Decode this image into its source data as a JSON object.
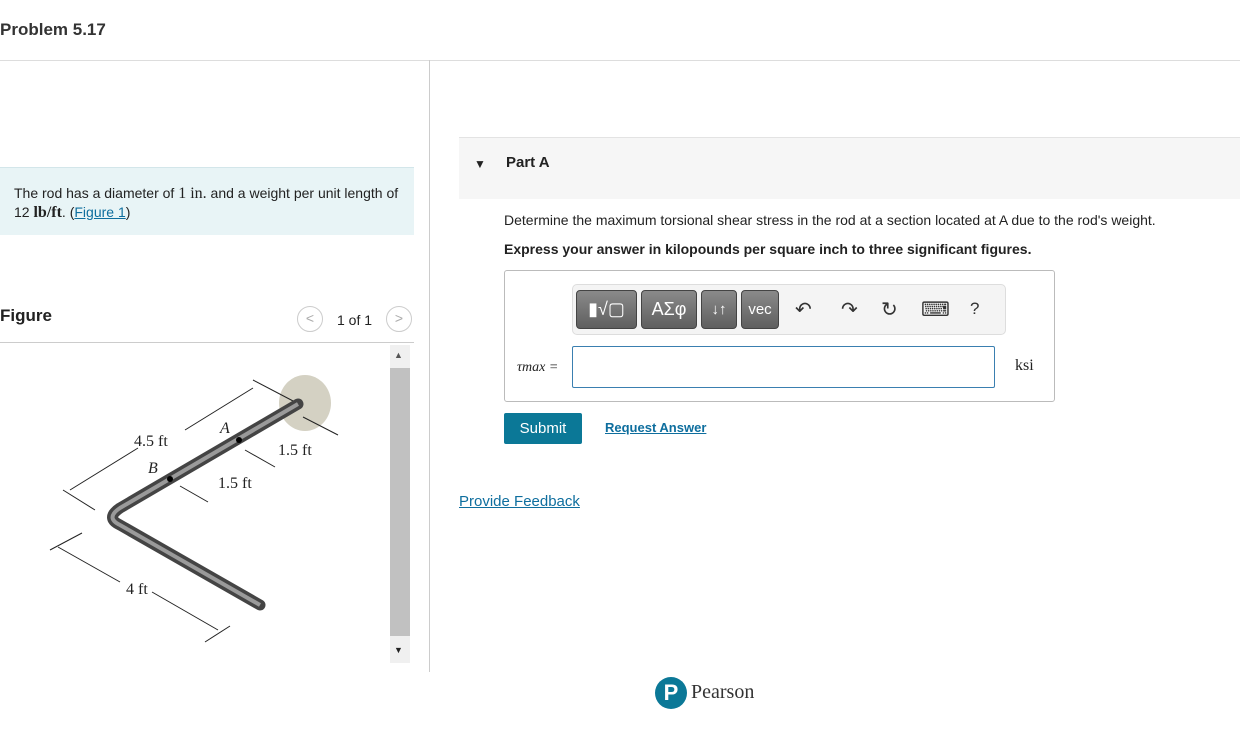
{
  "title": "Problem 5.17",
  "info": {
    "text1": "The rod has a diameter of ",
    "d": "1 in.",
    "text2": " and a weight per unit length of 12 ",
    "w": "lb/ft",
    "text3": ". (",
    "link": "Figure 1",
    "text4": ")"
  },
  "figure": {
    "label": "Figure",
    "pager": "1 of 1",
    "prev": "<",
    "next": ">",
    "labels": {
      "l45": "4.5 ft",
      "a": "A",
      "b": "B",
      "l15a": "1.5 ft",
      "l15b": "1.5 ft",
      "l4": "4 ft"
    }
  },
  "part": {
    "title": "Part A",
    "question": "Determine the maximum torsional shear stress in the rod at a section located at A due to the rod's weight.",
    "instruction": "Express your answer in kilopounds per square inch to three significant figures.",
    "toolbar": {
      "templates": "▮√▢",
      "greek": "ΑΣφ",
      "arrows": "↓↑",
      "vec": "vec",
      "undo": "↶",
      "redo": "↷",
      "reset": "↻",
      "keyboard": "⌨",
      "help": "?"
    },
    "var_label": "τmax =",
    "value": "",
    "unit": "ksi",
    "submit": "Submit",
    "request": "Request Answer"
  },
  "feedback": "Provide Feedback",
  "brand": "Pearson",
  "colors": {
    "accent": "#0b7897",
    "info_bg": "#e8f4f6"
  }
}
